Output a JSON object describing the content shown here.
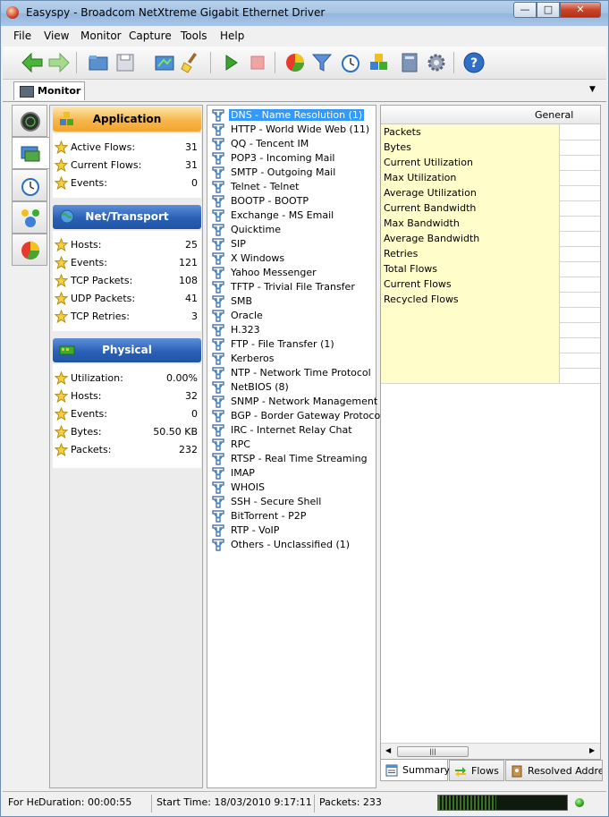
{
  "window": {
    "title": "Easyspy - Broadcom NetXtreme Gigabit Ethernet Driver"
  },
  "menu": [
    "File",
    "View",
    "Monitor",
    "Capture",
    "Tools",
    "Help"
  ],
  "toolbar": {
    "items": [
      "back-icon",
      "forward-icon",
      "open-folder-icon",
      "save-icon",
      "export-icon",
      "clear-icon",
      "play-icon",
      "stop-icon",
      "pie-chart-icon",
      "filter-icon",
      "clock-icon",
      "cubes-icon",
      "notebook-icon",
      "gear-icon",
      "help-icon"
    ]
  },
  "monitor_tab": {
    "label": "Monitor"
  },
  "stats": {
    "application": {
      "title": "Application",
      "rows": [
        {
          "label": "Active Flows:",
          "value": "31"
        },
        {
          "label": "Current Flows:",
          "value": "31"
        },
        {
          "label": "Events:",
          "value": "0"
        }
      ]
    },
    "net_transport": {
      "title": "Net/Transport",
      "rows": [
        {
          "label": "Hosts:",
          "value": "25"
        },
        {
          "label": "Events:",
          "value": "121"
        },
        {
          "label": "TCP Packets:",
          "value": "108"
        },
        {
          "label": "UDP Packets:",
          "value": "41"
        },
        {
          "label": "TCP Retries:",
          "value": "3"
        }
      ]
    },
    "physical": {
      "title": "Physical",
      "rows": [
        {
          "label": "Utilization:",
          "value": "0.00%"
        },
        {
          "label": "Hosts:",
          "value": "32"
        },
        {
          "label": "Events:",
          "value": "0"
        },
        {
          "label": "Bytes:",
          "value": "50.50 KB"
        },
        {
          "label": "Packets:",
          "value": "232"
        }
      ]
    }
  },
  "protocols": [
    "DNS - Name Resolution (1)",
    "HTTP - World Wide Web (11)",
    "QQ - Tencent IM",
    "POP3 - Incoming Mail",
    "SMTP - Outgoing Mail",
    "Telnet - Telnet",
    "BOOTP - BOOTP",
    "Exchange - MS Email",
    "Quicktime",
    "SIP",
    "X Windows",
    "Yahoo Messenger",
    "TFTP - Trivial File Transfer",
    "SMB",
    "Oracle",
    "H.323",
    "FTP - File Transfer (1)",
    "Kerberos",
    "NTP - Network Time Protocol",
    "NetBIOS (8)",
    "SNMP - Network Management",
    "BGP - Border Gateway Protocol",
    "IRC - Internet Relay Chat",
    "RPC",
    "RTSP - Real Time Streaming",
    "IMAP",
    "WHOIS",
    "SSH - Secure Shell",
    "BitTorrent - P2P",
    "RTP - VoIP",
    "Others - Unclassified (1)"
  ],
  "general": {
    "header": "General",
    "rows": [
      "Packets",
      "Bytes",
      "Current Utilization",
      "Max Utilization",
      "Average Utilization",
      "Current Bandwidth",
      "Max Bandwidth",
      "Average Bandwidth",
      "Retries",
      "Total Flows",
      "Current Flows",
      "Recycled Flows",
      "",
      "",
      "",
      "",
      ""
    ]
  },
  "bottom_tabs": [
    "Summary",
    "Flows",
    "Resolved Addresses"
  ],
  "status": {
    "help": "For He",
    "duration": "Duration: 00:00:55",
    "start_time": "Start Time: 18/03/2010 9:17:11",
    "packets": "Packets: 233",
    "meter_level": 0.45
  }
}
